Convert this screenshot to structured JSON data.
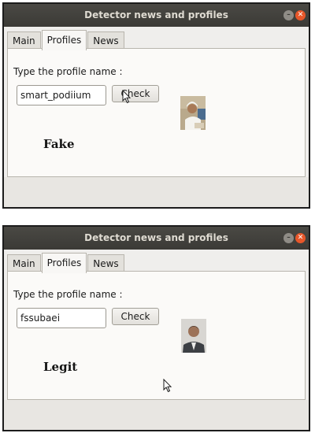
{
  "windows": [
    {
      "title": "Detector news and profiles",
      "tabs": [
        {
          "label": "Main",
          "active": false
        },
        {
          "label": "Profiles",
          "active": true
        },
        {
          "label": "News",
          "active": false
        }
      ],
      "prompt": "Type the profile name :",
      "input_value": "smart_podiium",
      "check_label": "Check",
      "result": "Fake"
    },
    {
      "title": "Detector news and profiles",
      "tabs": [
        {
          "label": "Main",
          "active": false
        },
        {
          "label": "Profiles",
          "active": true
        },
        {
          "label": "News",
          "active": false
        }
      ],
      "prompt": "Type the profile name :",
      "input_value": "fssubaei",
      "check_label": "Check",
      "result": "Legit"
    }
  ],
  "colors": {
    "titlebar": "#3b3a36",
    "close_button": "#e8572a",
    "panel_background": "#fbfaf8"
  },
  "icons": {
    "minimize": "minimize-icon",
    "close": "close-icon",
    "cursor": "mouse-cursor-icon"
  }
}
